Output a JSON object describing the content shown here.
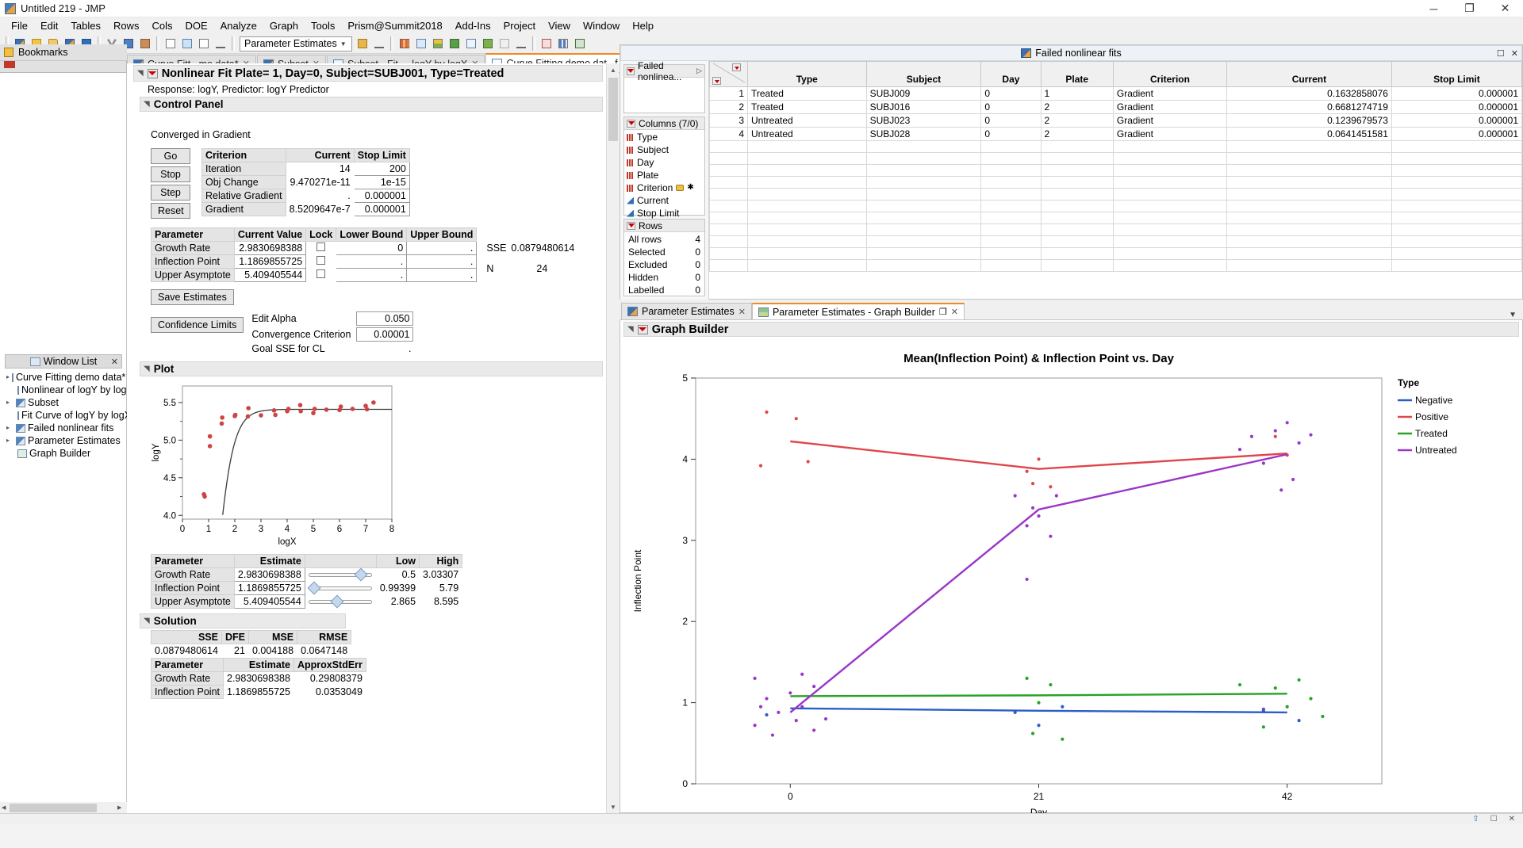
{
  "window": {
    "title": "Untitled 219 - JMP",
    "minimize": "─",
    "maximize": "❐",
    "close": "✕"
  },
  "menubar": [
    "File",
    "Edit",
    "Tables",
    "Rows",
    "Cols",
    "DOE",
    "Analyze",
    "Graph",
    "Tools",
    "Prism@Summit2018",
    "Add-Ins",
    "Project",
    "View",
    "Window",
    "Help"
  ],
  "toolbar": {
    "combo_value": "Parameter Estimates"
  },
  "tabs": [
    {
      "label": "Curve Fitt...mo data*",
      "active": false,
      "icon": "datatable-icon"
    },
    {
      "label": "Subset",
      "active": false,
      "icon": "datatable-icon"
    },
    {
      "label": "Subset - Fit ... logY by logX",
      "active": false,
      "icon": "report-icon"
    },
    {
      "label": "Curve Fitting demo dat...f logY by logY Predictor",
      "active": true,
      "icon": "nonlinear-icon"
    }
  ],
  "sidebar": {
    "bookmarks_label": "Bookmarks",
    "window_list_title": "Window List",
    "items": [
      {
        "label": "Curve Fitting demo data*",
        "indent": 0,
        "icon": "datatable-icon"
      },
      {
        "label": "Nonlinear of logY by logY I",
        "indent": 1,
        "icon": "report-icon"
      },
      {
        "label": "Subset",
        "indent": 0,
        "icon": "datatable-icon"
      },
      {
        "label": "Fit Curve of logY by logX",
        "indent": 1,
        "icon": "report-icon"
      },
      {
        "label": "Failed nonlinear fits",
        "indent": 0,
        "icon": "datatable-icon"
      },
      {
        "label": "Parameter Estimates",
        "indent": 0,
        "icon": "datatable-icon"
      },
      {
        "label": "Graph Builder",
        "indent": 1,
        "icon": "graph-icon"
      }
    ]
  },
  "report": {
    "title": "Nonlinear Fit Plate= 1, Day=0, Subject=SUBJ001, Type=Treated",
    "response_line": "Response: logY, Predictor: logY Predictor",
    "control_panel_label": "Control Panel",
    "converged_msg": "Converged in Gradient",
    "buttons": [
      "Go",
      "Stop",
      "Step",
      "Reset"
    ],
    "criterion_table": {
      "headers": [
        "Criterion",
        "Current",
        "Stop Limit"
      ],
      "rows": [
        {
          "criterion": "Iteration",
          "current": "14",
          "stop_limit": "200"
        },
        {
          "criterion": "Obj Change",
          "current": "9.470271e-11",
          "stop_limit": "1e-15"
        },
        {
          "criterion": "Relative Gradient",
          "current": ".",
          "stop_limit": "0.000001"
        },
        {
          "criterion": "Gradient",
          "current": "8.5209647e-7",
          "stop_limit": "0.000001"
        }
      ]
    },
    "param_table": {
      "headers": [
        "Parameter",
        "Current Value",
        "Lock",
        "Lower Bound",
        "Upper Bound"
      ],
      "rows": [
        {
          "parameter": "Growth Rate",
          "value": "2.9830698388",
          "lower": "0",
          "upper": "."
        },
        {
          "parameter": "Inflection Point",
          "value": "1.1869855725",
          "lower": ".",
          "upper": "."
        },
        {
          "parameter": "Upper Asymptote",
          "value": "5.409405544",
          "lower": ".",
          "upper": "."
        }
      ]
    },
    "sse_label": "SSE",
    "sse_value": "0.0879480614",
    "n_label": "N",
    "n_value": "24",
    "save_estimates_label": "Save Estimates",
    "confidence_limits_label": "Confidence Limits",
    "edit_alpha_label": "Edit Alpha",
    "edit_alpha_value": "0.050",
    "convergence_label": "Convergence Criterion",
    "convergence_value": "0.00001",
    "goal_sse_label": "Goal SSE for CL",
    "goal_sse_value": ".",
    "plot_label": "Plot",
    "estimate_table": {
      "headers": [
        "Parameter",
        "Estimate",
        "",
        "Low",
        "High"
      ],
      "rows": [
        {
          "parameter": "Growth Rate",
          "estimate": "2.9830698388",
          "low": "0.5",
          "high": "3.03307",
          "knob": 88
        },
        {
          "parameter": "Inflection Point",
          "estimate": "1.1869855725",
          "low": "0.99399",
          "high": "5.79",
          "knob": 2
        },
        {
          "parameter": "Upper Asymptote",
          "estimate": "5.409405544",
          "low": "2.865",
          "high": "8.595",
          "knob": 45
        }
      ]
    },
    "solution_label": "Solution",
    "solution_table": {
      "headers": [
        "SSE",
        "DFE",
        "MSE",
        "RMSE"
      ],
      "row": [
        "0.0879480614",
        "21",
        "0.004188",
        "0.0647148"
      ]
    },
    "approx_table": {
      "headers": [
        "Parameter",
        "Estimate",
        "ApproxStdErr"
      ],
      "rows": [
        {
          "parameter": "Growth Rate",
          "estimate": "2.9830698388",
          "stderr": "0.29808379"
        },
        {
          "parameter": "Inflection Point",
          "estimate": "1.1869855725",
          "stderr": "0.0353049"
        }
      ]
    }
  },
  "left_chart": {
    "type": "scatter",
    "title": "",
    "xlabel": "logX",
    "ylabel": "logY",
    "xlim": [
      0,
      8
    ],
    "ylim": [
      3.95,
      5.72
    ],
    "xticks": [
      0,
      1,
      2,
      3,
      4,
      5,
      6,
      7,
      8
    ],
    "yticks": [
      4.0,
      4.5,
      5.0,
      5.5
    ],
    "ytick_labels": [
      "4.0",
      "4.5",
      "5.0",
      "5.5"
    ],
    "point_color": "#cc4444",
    "curve_color": "#3a3a3a",
    "fit_model": "logistic-3p",
    "growth_rate": 2.9830698388,
    "inflection_point": 1.1869855725,
    "upper_asymptote": 5.409405544,
    "points": [
      [
        0.82,
        4.28
      ],
      [
        0.85,
        4.25
      ],
      [
        1.05,
        4.92
      ],
      [
        1.05,
        5.05
      ],
      [
        1.5,
        5.22
      ],
      [
        1.52,
        5.3
      ],
      [
        2.0,
        5.32
      ],
      [
        2.02,
        5.335
      ],
      [
        2.5,
        5.315
      ],
      [
        2.52,
        5.425
      ],
      [
        3.0,
        5.33
      ],
      [
        3.5,
        5.395
      ],
      [
        3.55,
        5.335
      ],
      [
        4.0,
        5.385
      ],
      [
        4.05,
        5.415
      ],
      [
        4.5,
        5.465
      ],
      [
        4.52,
        5.385
      ],
      [
        5.0,
        5.36
      ],
      [
        5.05,
        5.415
      ],
      [
        5.5,
        5.405
      ],
      [
        6.0,
        5.4
      ],
      [
        6.05,
        5.445
      ],
      [
        6.5,
        5.415
      ],
      [
        7.0,
        5.455
      ],
      [
        7.05,
        5.41
      ],
      [
        7.3,
        5.5
      ]
    ]
  },
  "datatable": {
    "window_title": "Failed nonlinear fits",
    "table_name": "Failed nonlinea...",
    "columns_label": "Columns (7/0)",
    "columns": [
      {
        "name": "Type",
        "icon": "nominal-icon"
      },
      {
        "name": "Subject",
        "icon": "nominal-icon"
      },
      {
        "name": "Day",
        "icon": "nominal-icon"
      },
      {
        "name": "Plate",
        "icon": "nominal-icon"
      },
      {
        "name": "Criterion",
        "icon": "nominal-icon",
        "badges": "formula-star"
      },
      {
        "name": "Current",
        "icon": "continuous-icon"
      },
      {
        "name": "Stop Limit",
        "icon": "continuous-icon"
      }
    ],
    "rows_label": "Rows",
    "row_stats": [
      {
        "label": "All rows",
        "value": "4"
      },
      {
        "label": "Selected",
        "value": "0"
      },
      {
        "label": "Excluded",
        "value": "0"
      },
      {
        "label": "Hidden",
        "value": "0"
      },
      {
        "label": "Labelled",
        "value": "0"
      }
    ],
    "grid_headers": [
      "Type",
      "Subject",
      "Day",
      "Plate",
      "Criterion",
      "Current",
      "Stop Limit"
    ],
    "grid_rows": [
      {
        "n": "1",
        "cells": [
          "Treated",
          "SUBJ009",
          "0",
          "1",
          "Gradient",
          "0.1632858076",
          "0.000001"
        ]
      },
      {
        "n": "2",
        "cells": [
          "Treated",
          "SUBJ016",
          "0",
          "2",
          "Gradient",
          "0.6681274719",
          "0.000001"
        ]
      },
      {
        "n": "3",
        "cells": [
          "Untreated",
          "SUBJ023",
          "0",
          "2",
          "Gradient",
          "0.1239679573",
          "0.000001"
        ]
      },
      {
        "n": "4",
        "cells": [
          "Untreated",
          "SUBJ028",
          "0",
          "2",
          "Gradient",
          "0.0641451581",
          "0.000001"
        ]
      }
    ]
  },
  "graphbuilder": {
    "tabs": [
      {
        "label": "Parameter Estimates",
        "active": false
      },
      {
        "label": "Parameter Estimates - Graph Builder",
        "active": true
      }
    ],
    "panel_label": "Graph Builder",
    "legend_title": "Type"
  },
  "chart_data": {
    "type": "scatter",
    "title": "Mean(Inflection Point) & Inflection Point vs. Day",
    "xlabel": "Day",
    "ylabel": "Inflection Point",
    "xlim": [
      -8,
      50
    ],
    "ylim": [
      0,
      5
    ],
    "xticks": [
      0,
      21,
      42
    ],
    "yticks": [
      0,
      1,
      2,
      3,
      4,
      5
    ],
    "grid": false,
    "legend_position": "right",
    "legend_title": "Type",
    "series": [
      {
        "name": "Negative",
        "color": "#2a5fc7",
        "line": [
          [
            0,
            0.93
          ],
          [
            21,
            0.9
          ],
          [
            42,
            0.88
          ]
        ]
      },
      {
        "name": "Positive",
        "color": "#e0454b",
        "line": [
          [
            0,
            4.22
          ],
          [
            21,
            3.88
          ],
          [
            42,
            4.07
          ]
        ]
      },
      {
        "name": "Treated",
        "color": "#26a326",
        "line": [
          [
            0,
            1.08
          ],
          [
            21,
            1.09
          ],
          [
            42,
            1.11
          ]
        ]
      },
      {
        "name": "Untreated",
        "color": "#9a35c9",
        "line": [
          [
            0,
            0.88
          ],
          [
            21,
            3.38
          ],
          [
            42,
            4.06
          ]
        ]
      }
    ],
    "points": {
      "Positive": [
        [
          -2,
          4.58
        ],
        [
          0.5,
          4.5
        ],
        [
          -2.5,
          3.92
        ],
        [
          1.5,
          3.97
        ],
        [
          21,
          4.0
        ],
        [
          20,
          3.85
        ],
        [
          20.5,
          3.7
        ],
        [
          22,
          3.66
        ],
        [
          41,
          4.28
        ],
        [
          42,
          4.05
        ]
      ],
      "Untreated": [
        [
          19,
          3.55
        ],
        [
          20,
          3.18
        ],
        [
          20.5,
          3.4
        ],
        [
          21,
          3.3
        ],
        [
          22,
          3.05
        ],
        [
          22.5,
          3.55
        ],
        [
          20,
          2.52
        ],
        [
          38,
          4.12
        ],
        [
          39,
          4.28
        ],
        [
          40,
          3.95
        ],
        [
          41,
          4.35
        ],
        [
          42,
          4.45
        ],
        [
          43,
          4.2
        ],
        [
          44,
          4.3
        ],
        [
          42.5,
          3.75
        ],
        [
          41.5,
          3.62
        ],
        [
          40,
          0.92
        ],
        [
          -3,
          1.3
        ],
        [
          -2,
          1.05
        ],
        [
          -1,
          0.88
        ],
        [
          0,
          1.12
        ],
        [
          1,
          0.95
        ],
        [
          2,
          1.2
        ],
        [
          -3,
          0.72
        ],
        [
          -1.5,
          0.6
        ],
        [
          0.5,
          0.78
        ],
        [
          2,
          0.66
        ],
        [
          -2.5,
          0.95
        ],
        [
          1,
          1.35
        ],
        [
          3,
          0.8
        ]
      ],
      "Treated": [
        [
          20,
          1.3
        ],
        [
          21,
          1.0
        ],
        [
          22,
          1.22
        ],
        [
          20.5,
          0.62
        ],
        [
          23,
          0.55
        ],
        [
          41,
          1.18
        ],
        [
          42,
          0.95
        ],
        [
          43,
          1.28
        ],
        [
          40,
          0.7
        ],
        [
          44,
          1.05
        ],
        [
          38,
          1.22
        ],
        [
          45,
          0.83
        ]
      ],
      "Negative": [
        [
          19,
          0.88
        ],
        [
          21,
          0.72
        ],
        [
          23,
          0.95
        ],
        [
          40,
          0.9
        ],
        [
          43,
          0.78
        ],
        [
          -2,
          0.85
        ]
      ]
    }
  },
  "statusbar": {
    "icons": [
      "up-arrow-icon",
      "window-icon",
      "close-icon"
    ]
  }
}
